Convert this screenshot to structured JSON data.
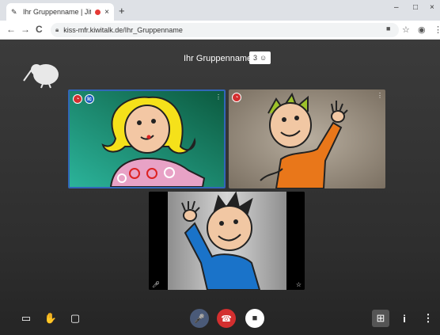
{
  "browser": {
    "tab_title": "Ihr Gruppenname | Jitsi Meet",
    "new_tab": "+",
    "tab_close": "×",
    "url": "kiss-mfr.kiwitalk.de/Ihr_Gruppenname",
    "nav_back": "←",
    "nav_forward": "→",
    "reload": "C",
    "home": "⌂",
    "minimize": "–",
    "maximize": "□",
    "close": "×"
  },
  "meeting": {
    "room_name": "Ihr Gruppenname",
    "participant_count": "3"
  },
  "tiles": [
    {
      "name": "girl-video",
      "bg": "#1f8c78"
    },
    {
      "name": "boy-wave-video",
      "bg": "#9c9486"
    },
    {
      "name": "boy-self-video",
      "bg": "#a9a9a9"
    }
  ],
  "toolbar": {
    "screen": "▭",
    "hand": "✋",
    "chat": "▢",
    "mic": "🎤",
    "hangup": "☎",
    "camera": "■",
    "tile_view": "⊞",
    "info": "i",
    "more": "⋮"
  },
  "colors": {
    "hangup": "#d32f2f",
    "active_border": "#3266b8"
  }
}
